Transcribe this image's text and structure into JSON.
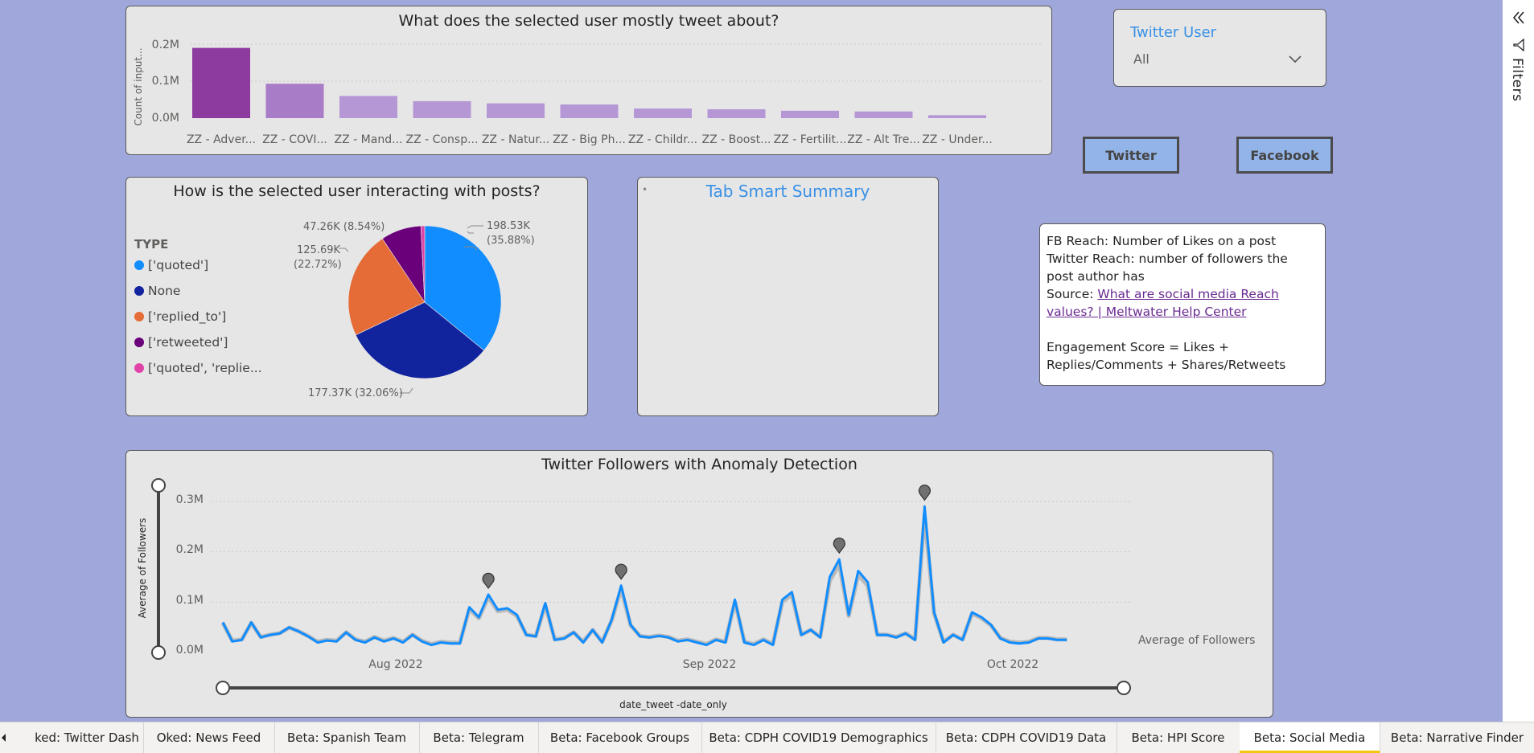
{
  "topics_chart": {
    "title": "What does the selected user mostly tweet about?",
    "ylabel": "Count of input...",
    "yticks": [
      "0.2M",
      "0.1M",
      "0.0M"
    ],
    "chart_data": {
      "type": "bar",
      "title": "What does the selected user mostly tweet about?",
      "ylabel": "Count of input...",
      "ylim": [
        0,
        200000
      ],
      "categories": [
        "ZZ - Adver...",
        "ZZ - COVI...",
        "ZZ - Mand...",
        "ZZ - Consp...",
        "ZZ - Natur...",
        "ZZ - Big Ph...",
        "ZZ - Childr...",
        "ZZ - Boost...",
        "ZZ - Fertilit...",
        "ZZ - Alt Tre...",
        "ZZ - Under..."
      ],
      "values": [
        190000,
        93000,
        60000,
        46000,
        40000,
        37000,
        26000,
        24000,
        20000,
        18000,
        8000
      ]
    }
  },
  "interaction_chart": {
    "title": "How is the selected user interacting with posts?",
    "legend_title": "TYPE",
    "legend": [
      {
        "label": "['quoted']",
        "color": "#118dff"
      },
      {
        "label": "None",
        "color": "#12239e"
      },
      {
        "label": "['replied_to']",
        "color": "#e66c37"
      },
      {
        "label": "['retweeted']",
        "color": "#6b007b"
      },
      {
        "label": "['quoted', 'replie...",
        "color": "#e044a7"
      }
    ],
    "slice_labels": {
      "quoted_1": "198.53K",
      "quoted_2": "(35.88%)",
      "none": "177.37K (32.06%)",
      "replied_1": "125.69K",
      "replied_2": "(22.72%)",
      "retweeted": "47.26K (8.54%)"
    },
    "chart_data": {
      "type": "pie",
      "title": "How is the selected user interacting with posts?",
      "legend_title": "TYPE",
      "categories": [
        "['quoted']",
        "None",
        "['replied_to']",
        "['retweeted']",
        "['quoted', 'replie..."
      ],
      "values": [
        198530,
        177370,
        125690,
        47260,
        4500
      ],
      "percents": [
        35.88,
        32.06,
        22.72,
        8.54,
        0.81
      ],
      "colors": [
        "#118dff",
        "#12239e",
        "#e66c37",
        "#6b007b",
        "#e044a7"
      ]
    }
  },
  "smart_summary": {
    "title": "Tab Smart Summary",
    "bullet": "•"
  },
  "slicer": {
    "title": "Twitter User",
    "value": "All"
  },
  "buttons": {
    "twitter": "Twitter",
    "facebook": "Facebook"
  },
  "info": {
    "line1": "FB Reach: Number of Likes on a post",
    "line2": "Twitter Reach: number of followers the post author has",
    "source_label": "Source: ",
    "source_link": "What are social media Reach values? | Meltwater Help Center",
    "line3": "Engagement Score = Likes + Replies/Comments + Shares/Retweets"
  },
  "followers_chart": {
    "title": "Twitter Followers with Anomaly Detection",
    "ylabel": "Average of Followers",
    "xlabel": "date_tweet -date_only",
    "series_label": "Average of Followers",
    "yticks": [
      "0.3M",
      "0.2M",
      "0.1M",
      "0.0M"
    ],
    "xticks": [
      "Aug 2022",
      "Sep 2022",
      "Oct 2022"
    ],
    "chart_data": {
      "type": "line",
      "title": "Twitter Followers with Anomaly Detection",
      "xlabel": "date_tweet -date_only",
      "ylabel": "Average of Followers",
      "ylim": [
        0,
        300000
      ],
      "x_start": "2022-07-16",
      "x_end": "2022-10-19",
      "series": [
        {
          "name": "Average of Followers",
          "values": [
            60000,
            22000,
            25000,
            60000,
            30000,
            35000,
            38000,
            50000,
            42000,
            32000,
            20000,
            24000,
            22000,
            40000,
            25000,
            20000,
            30000,
            22000,
            28000,
            20000,
            35000,
            22000,
            15000,
            20000,
            18000,
            18000,
            90000,
            70000,
            115000,
            85000,
            88000,
            75000,
            35000,
            32000,
            98000,
            25000,
            28000,
            40000,
            20000,
            45000,
            20000,
            65000,
            133000,
            55000,
            32000,
            30000,
            33000,
            30000,
            22000,
            25000,
            20000,
            15000,
            25000,
            20000,
            105000,
            20000,
            15000,
            25000,
            15000,
            105000,
            120000,
            35000,
            45000,
            30000,
            150000,
            185000,
            75000,
            162000,
            140000,
            35000,
            35000,
            30000,
            38000,
            25000,
            290000,
            80000,
            20000,
            35000,
            25000,
            80000,
            70000,
            55000,
            28000,
            20000,
            18000,
            20000,
            28000,
            28000,
            25000,
            25000
          ]
        }
      ],
      "anomalies": [
        {
          "date": "2022-08-13",
          "value": 115000
        },
        {
          "date": "2022-08-27",
          "value": 133000
        },
        {
          "date": "2022-09-19",
          "value": 185000
        },
        {
          "date": "2022-09-28",
          "value": 290000
        }
      ]
    }
  },
  "filters_pane": {
    "label": "Filters"
  },
  "tabs": [
    {
      "label": "ked: Twitter Dash"
    },
    {
      "label": "Oked: News Feed"
    },
    {
      "label": "Beta: Spanish Team"
    },
    {
      "label": "Beta: Telegram"
    },
    {
      "label": "Beta: Facebook Groups"
    },
    {
      "label": "Beta: CDPH COVID19 Demographics"
    },
    {
      "label": "Beta: CDPH COVID19 Data"
    },
    {
      "label": "Beta: HPI Score"
    },
    {
      "label": "Beta: Social Media"
    },
    {
      "label": "Beta: Narrative Finder"
    }
  ]
}
